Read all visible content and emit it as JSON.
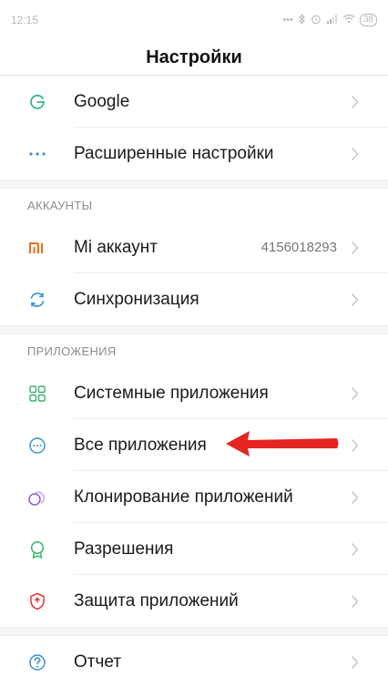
{
  "status_bar": {
    "time": "12:15",
    "battery": "38"
  },
  "header": {
    "title": "Настройки"
  },
  "rows_top": [
    {
      "label": "Google",
      "icon": "google-g-icon"
    },
    {
      "label": "Расширенные настройки",
      "icon": "more-dots-icon"
    }
  ],
  "section_accounts": {
    "title": "АККАУНТЫ",
    "items": [
      {
        "label": "Mi аккаунт",
        "value": "4156018293",
        "icon": "mi-logo-icon"
      },
      {
        "label": "Синхронизация",
        "icon": "sync-icon"
      }
    ]
  },
  "section_apps": {
    "title": "ПРИЛОЖЕНИЯ",
    "items": [
      {
        "label": "Системные приложения",
        "icon": "grid-apps-icon"
      },
      {
        "label": "Все приложения",
        "icon": "all-apps-icon"
      },
      {
        "label": "Клонирование приложений",
        "icon": "clone-icon"
      },
      {
        "label": "Разрешения",
        "icon": "permissions-icon"
      },
      {
        "label": "Защита приложений",
        "icon": "shield-icon"
      }
    ]
  },
  "rows_bottom": [
    {
      "label": "Отчет",
      "icon": "help-icon"
    }
  ],
  "colors": {
    "google": "#3fb38f",
    "accent_blue": "#3a8fd6",
    "mi_orange": "#f26b1d",
    "green": "#38b36f",
    "purple": "#8a5ccf",
    "shield_red": "#e0393e",
    "arrow_red": "#e52424"
  }
}
